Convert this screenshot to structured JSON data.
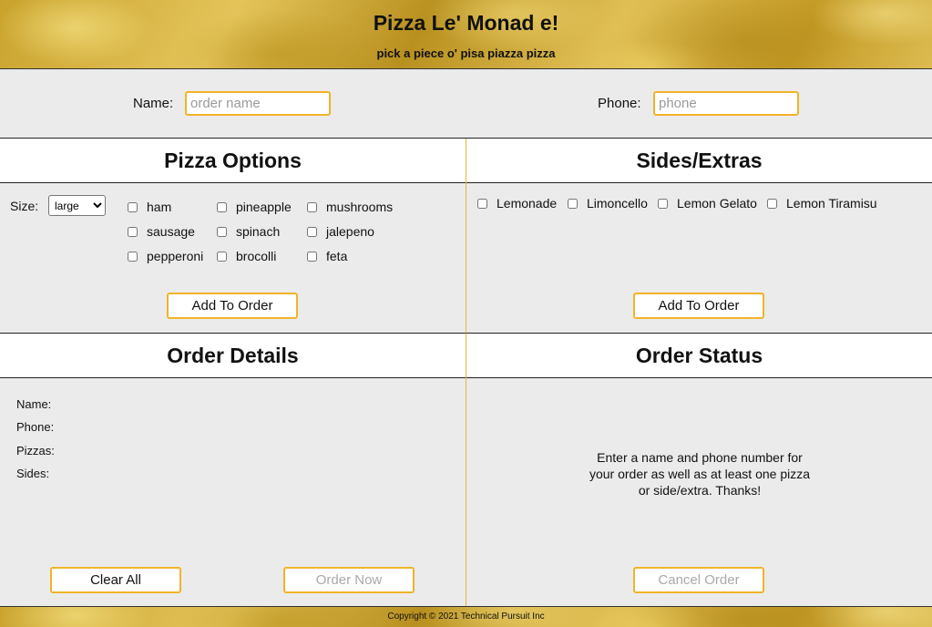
{
  "header": {
    "title": "Pizza Le' Monad e!",
    "subtitle": "pick a piece o' pisa piazza pizza"
  },
  "customer": {
    "name_label": "Name:",
    "name_placeholder": "order name",
    "name_value": "",
    "phone_label": "Phone:",
    "phone_placeholder": "phone",
    "phone_value": ""
  },
  "pizza_options": {
    "title": "Pizza Options",
    "size_label": "Size:",
    "size_selected": "large",
    "toppings": [
      {
        "label": "ham",
        "checked": false
      },
      {
        "label": "pineapple",
        "checked": false
      },
      {
        "label": "mushrooms",
        "checked": false
      },
      {
        "label": "sausage",
        "checked": false
      },
      {
        "label": "spinach",
        "checked": false
      },
      {
        "label": "jalepeno",
        "checked": false
      },
      {
        "label": "pepperoni",
        "checked": false
      },
      {
        "label": "brocolli",
        "checked": false
      },
      {
        "label": "feta",
        "checked": false
      }
    ],
    "add_button": "Add To Order"
  },
  "sides": {
    "title": "Sides/Extras",
    "items": [
      {
        "label": "Lemonade",
        "checked": false
      },
      {
        "label": "Limoncello",
        "checked": false
      },
      {
        "label": "Lemon Gelato",
        "checked": false
      },
      {
        "label": "Lemon Tiramisu",
        "checked": false
      }
    ],
    "add_button": "Add To Order"
  },
  "order_details": {
    "title": "Order Details",
    "name_label": "Name:",
    "phone_label": "Phone:",
    "pizzas_label": "Pizzas:",
    "sides_label": "Sides:",
    "clear_button": "Clear All",
    "order_button": "Order Now"
  },
  "order_status": {
    "title": "Order Status",
    "message": "Enter a name and phone number for your order as well as at least one pizza or side/extra. Thanks!",
    "cancel_button": "Cancel Order"
  },
  "footer": {
    "copyright": "Copyright © 2021 Technical Pursuit Inc"
  },
  "colors": {
    "accent_border": "#f0b429",
    "panel_bg": "#ebebeb",
    "header_bg": "#d7b23a"
  }
}
